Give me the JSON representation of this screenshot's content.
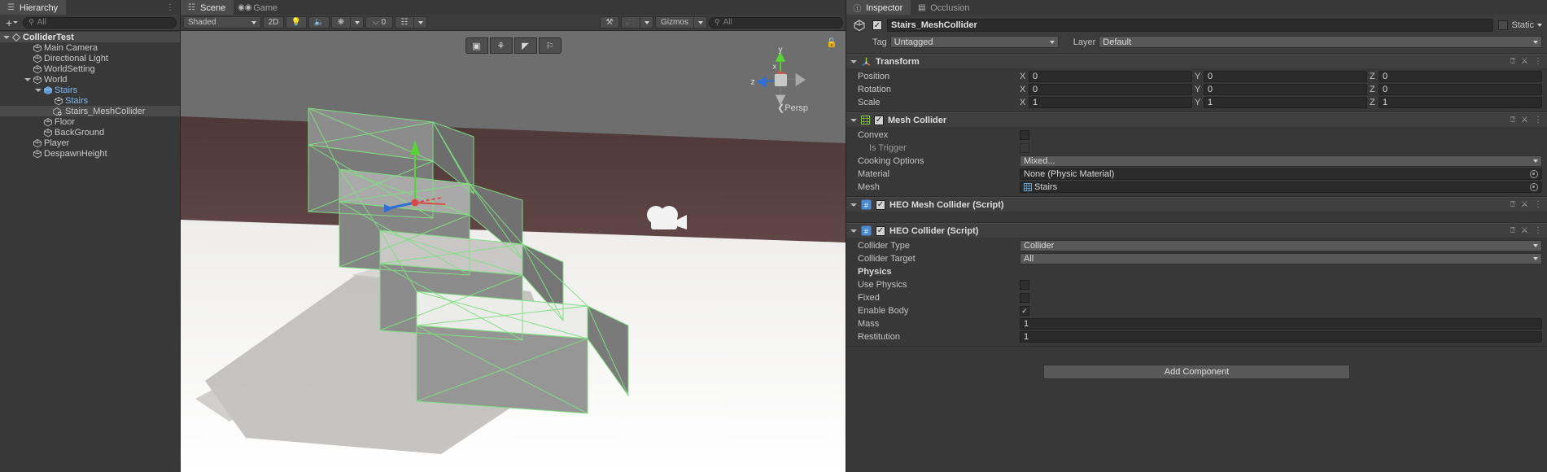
{
  "hierarchy": {
    "tab_label": "Hierarchy",
    "tab_icon": "hierarchy-icon",
    "create_label": "+",
    "search_placeholder": "All",
    "search_icon": "search-icon",
    "menu_icon": "kebab-menu-icon",
    "lock_icon": "lock-icon",
    "items": [
      {
        "label": "ColliderTest",
        "depth": 0,
        "icon": "unity-scene-icon",
        "expanded": true,
        "selected": false,
        "style": "bold"
      },
      {
        "label": "Main Camera",
        "depth": 2,
        "icon": "gameobject-icon",
        "expanded": false,
        "selected": false,
        "style": "normal"
      },
      {
        "label": "Directional Light",
        "depth": 2,
        "icon": "gameobject-icon",
        "expanded": false,
        "selected": false,
        "style": "normal"
      },
      {
        "label": "WorldSetting",
        "depth": 2,
        "icon": "gameobject-icon",
        "expanded": false,
        "selected": false,
        "style": "normal"
      },
      {
        "label": "World",
        "depth": 2,
        "icon": "gameobject-icon",
        "expanded": true,
        "selected": false,
        "style": "normal"
      },
      {
        "label": "Stairs",
        "depth": 3,
        "icon": "prefab-icon",
        "expanded": true,
        "selected": false,
        "style": "blue"
      },
      {
        "label": "Stairs",
        "depth": 4,
        "icon": "gameobject-icon",
        "expanded": false,
        "selected": false,
        "style": "blue"
      },
      {
        "label": "Stairs_MeshCollider",
        "depth": 4,
        "icon": "prefab-child-icon",
        "expanded": false,
        "selected": true,
        "style": "normal"
      },
      {
        "label": "Floor",
        "depth": 3,
        "icon": "gameobject-icon",
        "expanded": false,
        "selected": false,
        "style": "normal"
      },
      {
        "label": "BackGround",
        "depth": 3,
        "icon": "gameobject-icon",
        "expanded": false,
        "selected": false,
        "style": "normal"
      },
      {
        "label": "Player",
        "depth": 2,
        "icon": "gameobject-icon",
        "expanded": false,
        "selected": false,
        "style": "normal"
      },
      {
        "label": "DespawnHeight",
        "depth": 2,
        "icon": "gameobject-icon",
        "expanded": false,
        "selected": false,
        "style": "normal"
      }
    ]
  },
  "scene": {
    "tabs": [
      {
        "label": "Scene",
        "icon": "grid-icon",
        "active": true
      },
      {
        "label": "Game",
        "icon": "gamepad-icon",
        "active": false
      }
    ],
    "toolbar": {
      "shading_mode": "Shaded",
      "mode_2d": "2D",
      "lighting_icon": "lightbulb-icon",
      "audio_icon": "speaker-icon",
      "fx_icon": "effects-icon",
      "hidden_objects_icon": "eye-off-icon",
      "hidden_objects_count": "0",
      "grid_icon": "grid-visibility-icon",
      "tools_icon": "scene-tools-icon",
      "camera_icon": "scene-camera-icon",
      "gizmos_label": "Gizmos",
      "search_placeholder": "All",
      "search_icon": "search-icon"
    },
    "overlay_buttons": [
      {
        "icon": "move-tool-icon"
      },
      {
        "icon": "light-probe-icon"
      },
      {
        "icon": "paint-tool-icon"
      },
      {
        "icon": "flag-tool-icon"
      }
    ],
    "gizmo": {
      "axis_y": "y",
      "axis_x": "x",
      "axis_z": "z",
      "projection_label": "Persp"
    },
    "lock_icon": "lock-icon"
  },
  "inspector": {
    "tabs": [
      {
        "label": "Inspector",
        "icon": "info-icon",
        "active": true
      },
      {
        "label": "Occlusion",
        "icon": "occlusion-icon",
        "active": false
      }
    ],
    "object": {
      "icon": "gameobject-icon",
      "enabled": true,
      "name": "Stairs_MeshCollider",
      "static_label": "Static",
      "tag_label": "Tag",
      "tag_value": "Untagged",
      "layer_label": "Layer",
      "layer_value": "Default"
    },
    "components": [
      {
        "title": "Transform",
        "icon": "transform-icon",
        "has_checkbox": false,
        "expanded": true,
        "help_icon": "help-icon",
        "preset_icon": "preset-icon",
        "menu_icon": "kebab-menu-icon",
        "vec_rows": [
          {
            "label": "Position",
            "x": "0",
            "y": "0",
            "z": "0"
          },
          {
            "label": "Rotation",
            "x": "0",
            "y": "0",
            "z": "0"
          },
          {
            "label": "Scale",
            "x": "1",
            "y": "1",
            "z": "1"
          }
        ]
      },
      {
        "title": "Mesh Collider",
        "icon": "mesh-collider-icon",
        "has_checkbox": true,
        "checked": true,
        "expanded": true,
        "help_icon": "help-icon",
        "preset_icon": "preset-icon",
        "menu_icon": "kebab-menu-icon",
        "rows": [
          {
            "label": "Convex",
            "kind": "checkbox",
            "value": false,
            "dim": false
          },
          {
            "label": "Is Trigger",
            "kind": "checkbox",
            "value": false,
            "dim": true,
            "indent": true
          },
          {
            "label": "Cooking Options",
            "kind": "dropdown",
            "value": "Mixed..."
          },
          {
            "label": "Material",
            "kind": "object",
            "value": "None (Physic Material)",
            "obj_icon": ""
          },
          {
            "label": "Mesh",
            "kind": "object",
            "value": "Stairs",
            "obj_icon": "mesh-icon"
          }
        ]
      },
      {
        "title": "HEO Mesh Collider (Script)",
        "icon": "script-icon",
        "has_checkbox": true,
        "checked": true,
        "expanded": true,
        "help_icon": "help-icon",
        "preset_icon": "preset-icon",
        "menu_icon": "kebab-menu-icon",
        "rows": []
      },
      {
        "title": "HEO Collider (Script)",
        "icon": "script-icon",
        "has_checkbox": true,
        "checked": true,
        "expanded": true,
        "help_icon": "help-icon",
        "preset_icon": "preset-icon",
        "menu_icon": "kebab-menu-icon",
        "rows": [
          {
            "label": "Collider Type",
            "kind": "dropdown",
            "value": "Collider"
          },
          {
            "label": "Collider Target",
            "kind": "dropdown",
            "value": "All"
          },
          {
            "label": "Physics",
            "kind": "header"
          },
          {
            "label": "Use Physics",
            "kind": "checkbox",
            "value": false
          },
          {
            "label": "Fixed",
            "kind": "checkbox",
            "value": false
          },
          {
            "label": "Enable Body",
            "kind": "checkbox",
            "value": true
          },
          {
            "label": "Mass",
            "kind": "text",
            "value": "1"
          },
          {
            "label": "Restitution",
            "kind": "text",
            "value": "1"
          }
        ]
      }
    ],
    "add_component_label": "Add Component"
  },
  "colors": {
    "panel_bg": "#383838",
    "header_bg": "#3f3f3f",
    "field_bg": "#2a2a2a",
    "dropdown_bg": "#585858",
    "accent_blue": "#7fb8f0",
    "mesh_green": "#8fd44a",
    "script_blue": "#4b8bd1",
    "wire_green": "#7dd87d",
    "axis_x": "#e03a3a",
    "axis_y": "#5ad337",
    "axis_z": "#2e6bd8"
  }
}
